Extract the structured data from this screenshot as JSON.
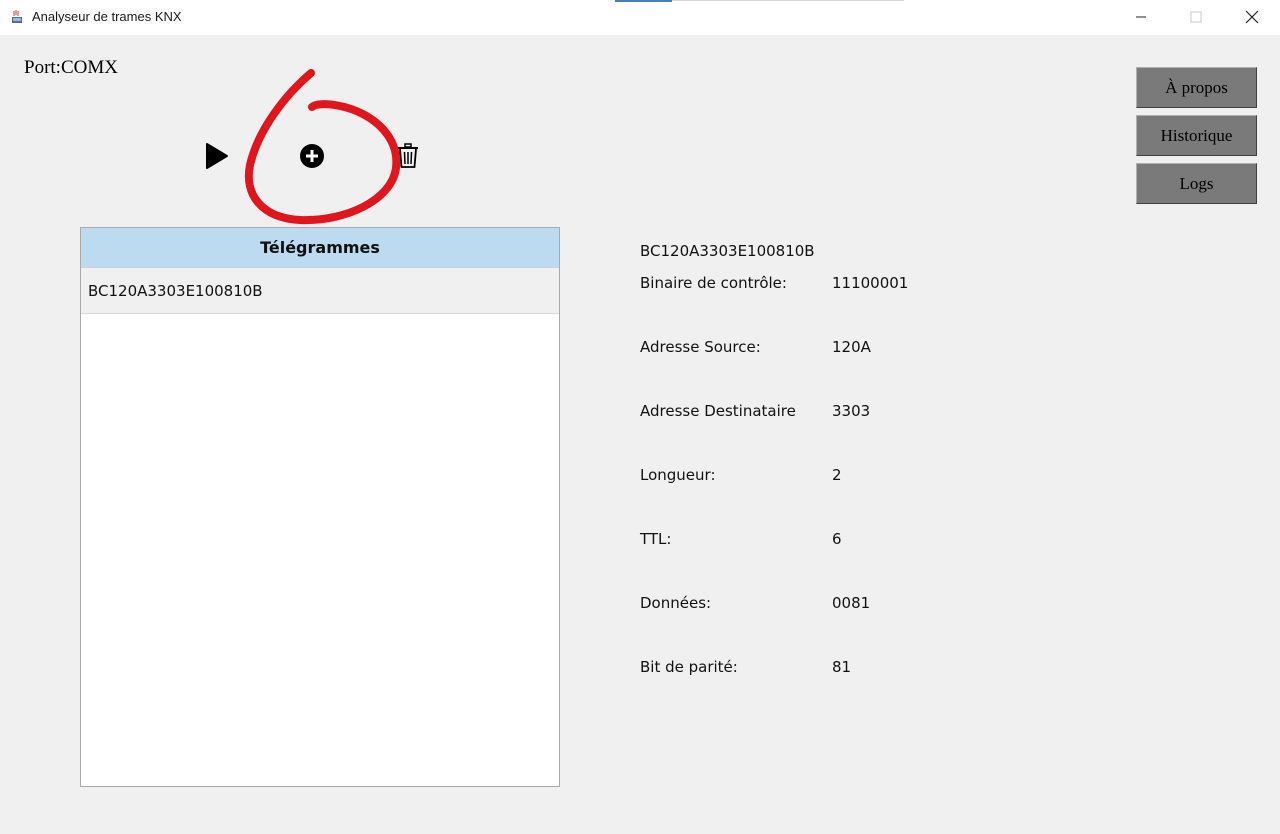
{
  "window": {
    "title": "Analyseur de trames KNX",
    "controls": [
      "minimize-icon",
      "maximize-icon",
      "close-icon"
    ]
  },
  "port": {
    "label": "Port:COMX"
  },
  "toolbar": {
    "icons": [
      "play-icon",
      "add-circle-icon",
      "trash-icon"
    ]
  },
  "side_buttons": {
    "about": "À propos",
    "history": "Historique",
    "logs": "Logs"
  },
  "telegrams": {
    "header": "Télégrammes",
    "rows": [
      "BC120A3303E100810B"
    ]
  },
  "details": {
    "frame": "BC120A3303E100810B",
    "fields": [
      {
        "label": "Binaire de contrôle:",
        "value": "11100001"
      },
      {
        "label": "Adresse Source:",
        "value": "120A"
      },
      {
        "label": "Adresse Destinataire",
        "value": "3303"
      },
      {
        "label": "Longueur:",
        "value": "2"
      },
      {
        "label": "TTL:",
        "value": "6"
      },
      {
        "label": "Données:",
        "value": "0081"
      },
      {
        "label": "Bit de parité:",
        "value": "81"
      }
    ]
  },
  "annotation": {
    "color": "#e0161c",
    "shape": "hand-drawn-circle",
    "target": "add-circle-icon"
  }
}
